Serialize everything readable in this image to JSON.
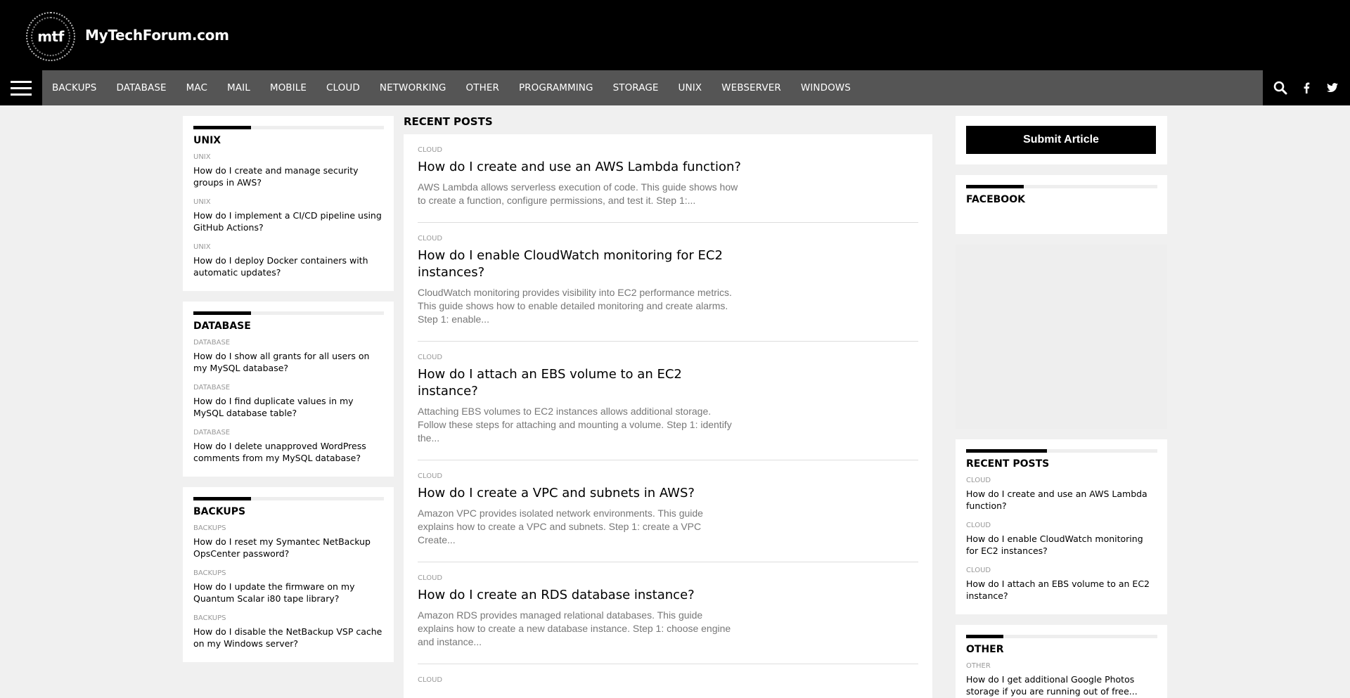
{
  "site": {
    "logo_text": "mtf",
    "name": "MyTechForum.com"
  },
  "nav": {
    "items": [
      "BACKUPS",
      "DATABASE",
      "MAC",
      "MAIL",
      "MOBILE",
      "CLOUD",
      "NETWORKING",
      "OTHER",
      "PROGRAMMING",
      "STORAGE",
      "UNIX",
      "WEBSERVER",
      "WINDOWS"
    ],
    "icons": [
      "search-icon",
      "facebook-icon",
      "twitter-icon"
    ]
  },
  "left_widgets": [
    {
      "title": "UNIX",
      "items": [
        {
          "category": "UNIX",
          "title": "How do I create and manage security groups in AWS?"
        },
        {
          "category": "UNIX",
          "title": "How do I implement a CI/CD pipeline using GitHub Actions?"
        },
        {
          "category": "UNIX",
          "title": "How do I deploy Docker containers with automatic updates?"
        }
      ]
    },
    {
      "title": "DATABASE",
      "items": [
        {
          "category": "DATABASE",
          "title": "How do I show all grants for all users on my MySQL database?"
        },
        {
          "category": "DATABASE",
          "title": "How do I find duplicate values in my MySQL database table?"
        },
        {
          "category": "DATABASE",
          "title": "How do I delete unapproved WordPress comments from my MySQL database?"
        }
      ]
    },
    {
      "title": "BACKUPS",
      "items": [
        {
          "category": "BACKUPS",
          "title": "How do I reset my Symantec NetBackup OpsCenter password?"
        },
        {
          "category": "BACKUPS",
          "title": "How do I update the firmware on my Quantum Scalar i80 tape library?"
        },
        {
          "category": "BACKUPS",
          "title": "How do I disable the NetBackup VSP cache on my Windows server?"
        }
      ]
    }
  ],
  "main": {
    "section_title": "RECENT POSTS",
    "posts": [
      {
        "category": "CLOUD",
        "title": "How do I create and use an AWS Lambda function?",
        "excerpt": "AWS Lambda allows serverless execution of code. This guide shows how to create a function, configure permissions, and test it. Step 1:..."
      },
      {
        "category": "CLOUD",
        "title": "How do I enable CloudWatch monitoring for EC2 instances?",
        "excerpt": "CloudWatch monitoring provides visibility into EC2 performance metrics. This guide shows how to enable detailed monitoring and create alarms. Step 1: enable..."
      },
      {
        "category": "CLOUD",
        "title": "How do I attach an EBS volume to an EC2 instance?",
        "excerpt": "Attaching EBS volumes to EC2 instances allows additional storage. Follow these steps for attaching and mounting a volume. Step 1: identify the..."
      },
      {
        "category": "CLOUD",
        "title": "How do I create a VPC and subnets in AWS?",
        "excerpt": "Amazon VPC provides isolated network environments. This guide explains how to create a VPC and subnets. Step 1: create a VPC Create..."
      },
      {
        "category": "CLOUD",
        "title": "How do I create an RDS database instance?",
        "excerpt": "Amazon RDS provides managed relational databases. This guide explains how to create a new database instance. Step 1: choose engine and instance..."
      },
      {
        "category": "CLOUD",
        "title": "",
        "excerpt": ""
      }
    ]
  },
  "right": {
    "submit_label": "Submit Article",
    "facebook_title": "FACEBOOK",
    "recent_title": "RECENT POSTS",
    "recent_items": [
      {
        "category": "CLOUD",
        "title": "How do I create and use an AWS Lambda function?"
      },
      {
        "category": "CLOUD",
        "title": "How do I enable CloudWatch monitoring for EC2 instances?"
      },
      {
        "category": "CLOUD",
        "title": "How do I attach an EBS volume to an EC2 instance?"
      }
    ],
    "other_title": "OTHER",
    "other_items": [
      {
        "category": "OTHER",
        "title": "How do I get additional Google Photos storage if you are running out of free..."
      }
    ]
  }
}
